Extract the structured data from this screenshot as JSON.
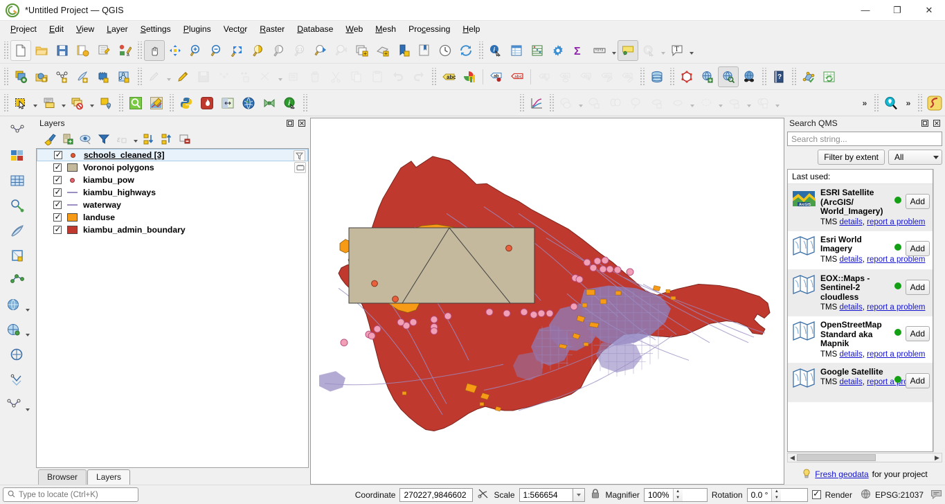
{
  "window": {
    "title": "*Untitled Project — QGIS",
    "logo_icon": "qgis-logo-icon",
    "minimize_label": "—",
    "maximize_label": "❐",
    "close_label": "✕"
  },
  "menubar": {
    "items": [
      {
        "label": "Project",
        "accel": "P"
      },
      {
        "label": "Edit",
        "accel": "E"
      },
      {
        "label": "View",
        "accel": "V"
      },
      {
        "label": "Layer",
        "accel": "L"
      },
      {
        "label": "Settings",
        "accel": "S"
      },
      {
        "label": "Plugins",
        "accel": "P"
      },
      {
        "label": "Vector",
        "accel": "o"
      },
      {
        "label": "Raster",
        "accel": "R"
      },
      {
        "label": "Database",
        "accel": "D"
      },
      {
        "label": "Web",
        "accel": "W"
      },
      {
        "label": "Mesh",
        "accel": "M"
      },
      {
        "label": "Processing",
        "accel": "c"
      },
      {
        "label": "Help",
        "accel": "H"
      }
    ]
  },
  "toolbar_row1": {
    "tools": [
      "new-project-icon",
      "open-project-icon",
      "save-project-icon",
      "save-project-as-icon",
      "new-print-layout-icon",
      "style-manager-icon",
      "pan-map-icon",
      "pan-to-selection-icon",
      "zoom-in-icon",
      "zoom-out-icon",
      "zoom-full-icon",
      "zoom-to-selection-icon",
      "zoom-to-layer-icon",
      "zoom-native-icon",
      "zoom-last-icon",
      "zoom-next-icon",
      "new-map-view-icon",
      "new-3d-map-view-icon",
      "new-bookmark-icon",
      "show-bookmarks-icon",
      "temporal-controller-icon",
      "refresh-icon",
      "identify-features-icon",
      "open-attribute-table-icon",
      "field-calculator-icon",
      "options-icon",
      "statistical-summary-icon",
      "measure-line-icon",
      "map-tips-icon",
      "run-feature-action-icon",
      "text-annotation-icon"
    ]
  },
  "toolbar_row2": {
    "tools": [
      "add-layer-icon",
      "add-raster-layer-icon",
      "add-vector-layer-icon",
      "add-delimited-text-icon",
      "add-mesh-layer-icon",
      "add-postgis-layer-icon",
      "current-edits-icon",
      "toggle-editing-icon",
      "save-layer-edits-icon",
      "add-feature-icon",
      "add-point-feature-icon",
      "vertex-tool-icon",
      "modify-attributes-icon",
      "delete-selected-icon",
      "cut-features-icon",
      "copy-features-icon",
      "paste-features-icon",
      "undo-icon",
      "redo-icon",
      "label-toolbar-icon",
      "diagram-icon",
      "pin-labels-icon",
      "highlight-labels-icon",
      "show-hide-labels-icon",
      "move-label-icon",
      "rotate-label-icon",
      "change-label-icon",
      "database-manager-icon",
      "geometry-checker-icon",
      "topology-checker-icon",
      "metasearch-icon",
      "qms-search-icon",
      "qms-preview-icon",
      "help-icon",
      "processing-toolbox-icon",
      "refresh-table-icon"
    ]
  },
  "toolbar_row3": {
    "tools": [
      "select-features-icon",
      "select-by-layer-icon",
      "deselect-features-icon",
      "select-location-icon",
      "zoom-search-icon",
      "qgis-style-icon",
      "python-console-icon",
      "flame-plugin-icon",
      "swipe-tool-icon",
      "globe-icon",
      "bowtie-icon",
      "info-icon",
      "plot-icon",
      "geoprocess-icon",
      "geoprocess-clip-icon",
      "geoprocess-scissor-icon",
      "geoprocess-convex-icon",
      "geoprocess-dissolve-icon",
      "geoprocess-buffer-icon",
      "geoprocess-dash-icon",
      "geoprocess-union-icon",
      "geoprocess-intersect-icon",
      "overflow-icon",
      "geocoding-search-icon",
      "overflow2-icon",
      "route-icon"
    ]
  },
  "left_toolbar": {
    "tools": [
      "digitize-line-icon",
      "digitize-shape-icon",
      "digitize-grid-icon",
      "digitize-circle-icon",
      "digitize-pen-icon",
      "digitize-polygon-icon",
      "digitize-node-icon",
      "digitize-globe-icon",
      "digitize-net-icon",
      "digitize-chain-icon",
      "digitize-vertex-icon"
    ]
  },
  "layers_panel": {
    "title": "Layers",
    "float_icon": "float-panel-icon",
    "close_icon": "close-panel-icon",
    "toolbar": [
      "open-layer-styling-icon",
      "add-group-icon",
      "manage-visibility-icon",
      "filter-legend-icon",
      "filter-expression-icon",
      "expand-all-icon",
      "collapse-all-icon",
      "remove-layer-icon"
    ],
    "layers": [
      {
        "name": "schools_cleaned [3]",
        "symbol": "point",
        "color": "#e4572e",
        "checked": true,
        "selected": true,
        "badge": "filter-badge-icon"
      },
      {
        "name": "Voronoi polygons",
        "symbol": "polygon",
        "color": "#c4b89d",
        "checked": true,
        "selected": false,
        "badge": "memory-layer-badge-icon"
      },
      {
        "name": "kiambu_pow",
        "symbol": "point",
        "color": "#e06377",
        "checked": true,
        "selected": false,
        "badge": ""
      },
      {
        "name": "kiambu_highways",
        "symbol": "line",
        "color": "#9b8ec4",
        "checked": true,
        "selected": false,
        "badge": ""
      },
      {
        "name": "waterway",
        "symbol": "line",
        "color": "#9b8ec4",
        "checked": true,
        "selected": false,
        "badge": ""
      },
      {
        "name": "landuse",
        "symbol": "polygon",
        "color": "#f79a16",
        "checked": true,
        "selected": false,
        "badge": ""
      },
      {
        "name": "kiambu_admin_boundary",
        "symbol": "polygon",
        "color": "#c0392f",
        "checked": true,
        "selected": false,
        "badge": ""
      }
    ],
    "tabs": [
      {
        "label": "Browser",
        "active": false
      },
      {
        "label": "Layers",
        "active": true
      }
    ]
  },
  "qms_panel": {
    "title": "Search QMS",
    "float_icon": "float-panel-icon",
    "close_icon": "close-panel-icon",
    "search_placeholder": "Search string...",
    "search_value": "",
    "filter_button": "Filter by extent",
    "filter_select": "All",
    "list_header": "Last used:",
    "add_label": "Add",
    "services": [
      {
        "name": "ESRI Satellite (ArcGIS/ World_Imagery)",
        "type": "TMS",
        "details": "details",
        "separator": ",",
        "report": "report a problem",
        "status_color": "#14a014",
        "icon": "esri-satellite-icon"
      },
      {
        "name": "Esri World Imagery",
        "type": "TMS",
        "details": "details",
        "separator": ",",
        "report": "report a problem",
        "status_color": "#14a014",
        "icon": "map-service-icon"
      },
      {
        "name": "EOX::Maps - Sentinel-2 cloudless",
        "type": "TMS",
        "details": "details",
        "separator": ",",
        "report": "report a problem",
        "status_color": "#14a014",
        "icon": "map-service-icon"
      },
      {
        "name": "OpenStreetMap Standard aka Mapnik",
        "type": "TMS",
        "details": "details",
        "separator": ",",
        "report": "report a problem",
        "status_color": "#14a014",
        "icon": "map-service-icon"
      },
      {
        "name": "Google Satellite",
        "type": "TMS",
        "details": "details",
        "separator": ",",
        "report": "report a problem",
        "status_color": "#14a014",
        "icon": "map-service-icon"
      }
    ],
    "footer": {
      "icon": "lightbulb-icon",
      "link": "Fresh geodata",
      "text": "for your project"
    }
  },
  "statusbar": {
    "locator_placeholder": "Type to locate (Ctrl+K)",
    "locator_icon": "search-icon",
    "coordinate_label": "Coordinate",
    "coordinate_value": "270227,9846602",
    "coordinate_toggle_icon": "toggle-extents-icon",
    "scale_label": "Scale",
    "scale_value": "1:566654",
    "lock_icon": "lock-scale-icon",
    "magnifier_label": "Magnifier",
    "magnifier_value": "100%",
    "rotation_label": "Rotation",
    "rotation_value": "0.0 °",
    "render_label": "Render",
    "render_checked": true,
    "crs_label": "EPSG:21037",
    "crs_icon": "globe-icon",
    "messages_icon": "messages-icon"
  },
  "map": {
    "colors": {
      "admin_boundary": "#c0392f",
      "landuse": "#f79a16",
      "voronoi": "#c4b89d",
      "highways": "#8d7fbe",
      "waterway": "#9b8ec4",
      "school_point": "#e8603c",
      "pow_point": "#f2a0b5",
      "canvas_bg": "#ffffff"
    }
  }
}
